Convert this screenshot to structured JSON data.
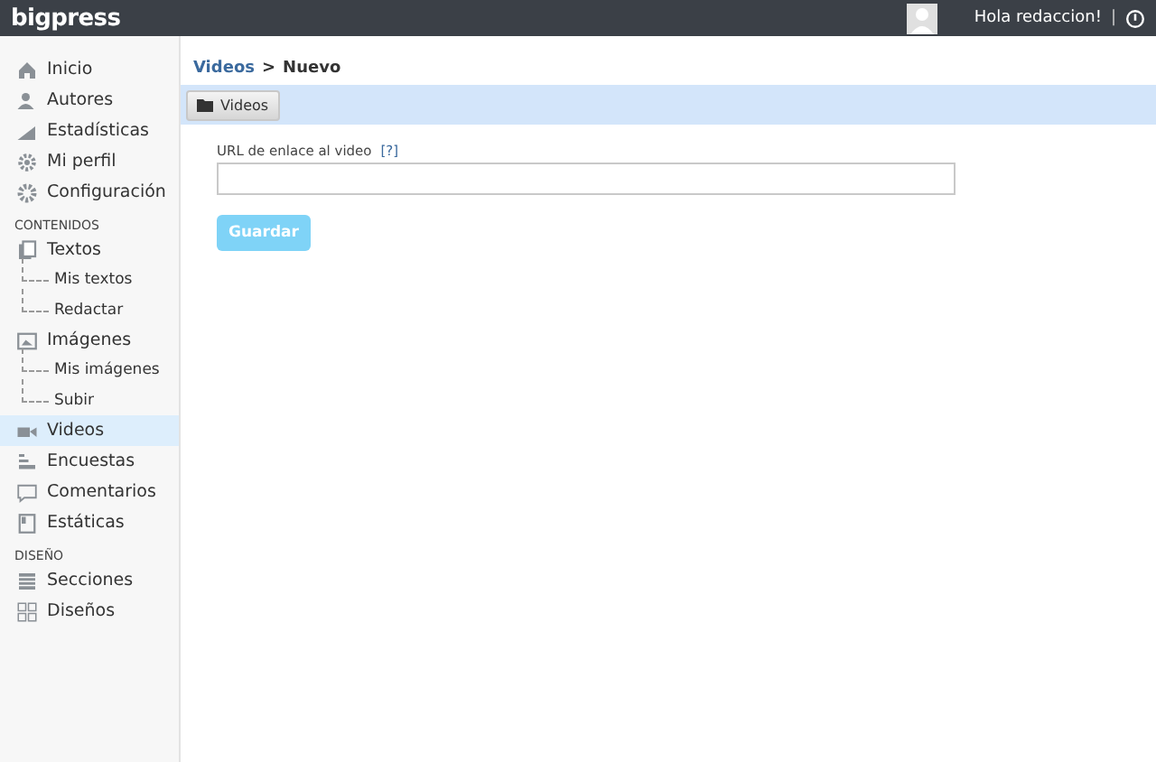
{
  "topbar": {
    "logo": "bigpress",
    "greeting": "Hola redaccion!",
    "separator": "|"
  },
  "sidebar": {
    "items": [
      {
        "kind": "item",
        "label": "Inicio",
        "selected": false
      },
      {
        "kind": "item",
        "label": "Autores",
        "selected": false
      },
      {
        "kind": "item",
        "label": "Estadísticas",
        "selected": false
      },
      {
        "kind": "item",
        "label": "Mi perfil",
        "selected": false
      },
      {
        "kind": "item",
        "label": "Configuración",
        "selected": false
      },
      {
        "kind": "heading",
        "label": "CONTENIDOS"
      },
      {
        "kind": "item",
        "label": "Textos",
        "selected": false,
        "children": [
          {
            "label": "Mis textos",
            "selected": false
          },
          {
            "label": "Redactar",
            "selected": false
          }
        ]
      },
      {
        "kind": "item",
        "label": "Imágenes",
        "selected": false,
        "children": [
          {
            "label": "Mis imágenes",
            "selected": false
          },
          {
            "label": "Subir",
            "selected": false
          }
        ]
      },
      {
        "kind": "item",
        "label": "Videos",
        "selected": true
      },
      {
        "kind": "item",
        "label": "Encuestas",
        "selected": false
      },
      {
        "kind": "item",
        "label": "Comentarios",
        "selected": false
      },
      {
        "kind": "item",
        "label": "Estáticas",
        "selected": false
      },
      {
        "kind": "heading",
        "label": "DISEÑO"
      },
      {
        "kind": "item",
        "label": "Secciones",
        "selected": false
      },
      {
        "kind": "item",
        "label": "Diseños",
        "selected": false
      }
    ]
  },
  "breadcrumb": {
    "link": "Videos",
    "separator": ">",
    "current": "Nuevo"
  },
  "toolbar": {
    "button": "Videos"
  },
  "form": {
    "label": "URL de enlace al video",
    "help": "[?]",
    "submit": "Guardar"
  }
}
